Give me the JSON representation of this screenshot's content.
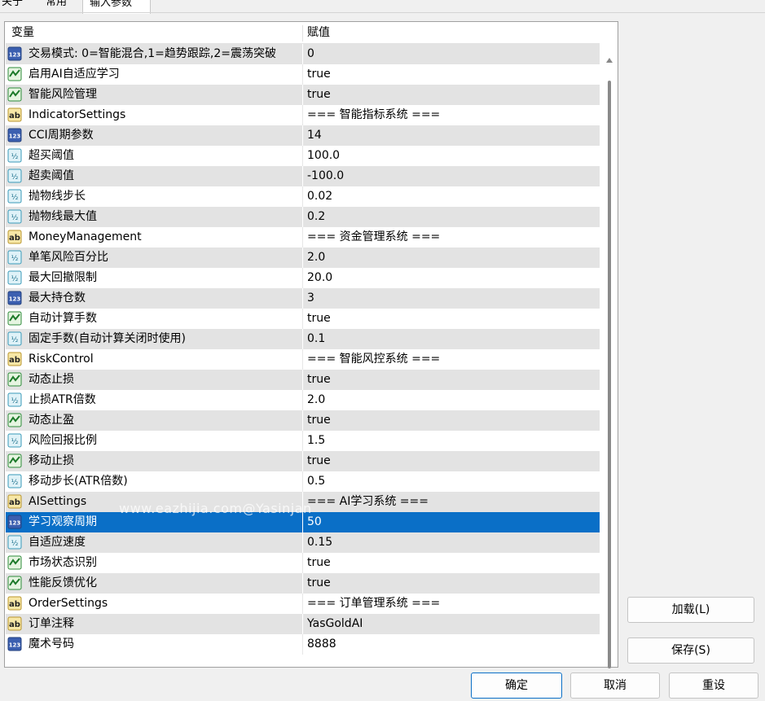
{
  "tabs": [
    {
      "label": "关于"
    },
    {
      "label": "常用"
    },
    {
      "label": "输入参数"
    }
  ],
  "table": {
    "header": {
      "variable": "变量",
      "value": "赋值"
    },
    "rows": [
      {
        "icon": "int-icon",
        "name": "交易模式: 0=智能混合,1=趋势跟踪,2=震荡突破",
        "value": "0"
      },
      {
        "icon": "bool-icon",
        "name": "启用AI自适应学习",
        "value": "true"
      },
      {
        "icon": "bool-icon",
        "name": "智能风险管理",
        "value": "true"
      },
      {
        "icon": "string-icon",
        "name": "IndicatorSettings",
        "value": "=== 智能指标系统 ==="
      },
      {
        "icon": "int-icon",
        "name": "CCI周期参数",
        "value": "14"
      },
      {
        "icon": "double-icon",
        "name": "超买阈值",
        "value": "100.0"
      },
      {
        "icon": "double-icon",
        "name": "超卖阈值",
        "value": "-100.0"
      },
      {
        "icon": "double-icon",
        "name": "抛物线步长",
        "value": "0.02"
      },
      {
        "icon": "double-icon",
        "name": "抛物线最大值",
        "value": "0.2"
      },
      {
        "icon": "string-icon",
        "name": "MoneyManagement",
        "value": "=== 资金管理系统 ==="
      },
      {
        "icon": "double-icon",
        "name": "单笔风险百分比",
        "value": "2.0"
      },
      {
        "icon": "double-icon",
        "name": "最大回撤限制",
        "value": "20.0"
      },
      {
        "icon": "int-icon",
        "name": "最大持仓数",
        "value": "3"
      },
      {
        "icon": "bool-icon",
        "name": "自动计算手数",
        "value": "true"
      },
      {
        "icon": "double-icon",
        "name": "固定手数(自动计算关闭时使用)",
        "value": "0.1"
      },
      {
        "icon": "string-icon",
        "name": "RiskControl",
        "value": "=== 智能风控系统 ==="
      },
      {
        "icon": "bool-icon",
        "name": "动态止损",
        "value": "true"
      },
      {
        "icon": "double-icon",
        "name": "止损ATR倍数",
        "value": "2.0"
      },
      {
        "icon": "bool-icon",
        "name": "动态止盈",
        "value": "true"
      },
      {
        "icon": "double-icon",
        "name": "风险回报比例",
        "value": "1.5"
      },
      {
        "icon": "bool-icon",
        "name": "移动止损",
        "value": "true"
      },
      {
        "icon": "double-icon",
        "name": "移动步长(ATR倍数)",
        "value": "0.5"
      },
      {
        "icon": "string-icon",
        "name": "AISettings",
        "value": "=== AI学习系统 ==="
      },
      {
        "icon": "int-icon",
        "name": "学习观察周期",
        "value": "50",
        "selected": true
      },
      {
        "icon": "double-icon",
        "name": "自适应速度",
        "value": "0.15"
      },
      {
        "icon": "bool-icon",
        "name": "市场状态识别",
        "value": "true"
      },
      {
        "icon": "bool-icon",
        "name": "性能反馈优化",
        "value": "true"
      },
      {
        "icon": "string-icon",
        "name": "OrderSettings",
        "value": "=== 订单管理系统 ==="
      },
      {
        "icon": "string-icon",
        "name": "订单注释",
        "value": "YasGoldAI"
      },
      {
        "icon": "int-icon",
        "name": "魔术号码",
        "value": "8888"
      }
    ]
  },
  "watermark": "www.eazhijia.com@Yasinjan",
  "buttons": {
    "load": "加载(L)",
    "save": "保存(S)",
    "ok": "确定",
    "cancel": "取消",
    "reset": "重设"
  },
  "colors": {
    "selection": "#0a6fc7",
    "row_alt": "#e3e3e3"
  }
}
